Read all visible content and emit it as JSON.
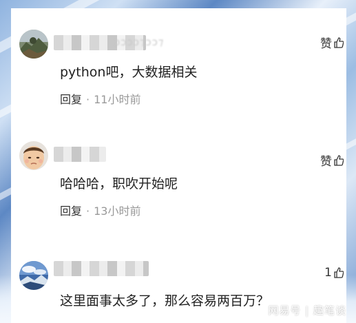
{
  "comments": [
    {
      "username_visible": "ɔɔɔɔ⁊ɔɔ⁊",
      "text": "python吧，大数据相关",
      "reply_label": "回复",
      "separator": "·",
      "time": "11小时前",
      "like_label": "赞",
      "avatar_icon": "landscape-avatar"
    },
    {
      "username_visible": "",
      "text": "哈哈哈，职吹开始呢",
      "reply_label": "回复",
      "separator": "·",
      "time": "13小时前",
      "like_label": "赞",
      "avatar_icon": "child-avatar"
    },
    {
      "username_visible": "",
      "text": "这里面事太多了，那么容易两百万？",
      "like_label": "1",
      "avatar_icon": "sky-avatar"
    }
  ],
  "watermark": "网易号 | 趣笔谈",
  "colors": {
    "card": "#ffffff",
    "text": "#222222",
    "meta": "#999999"
  }
}
